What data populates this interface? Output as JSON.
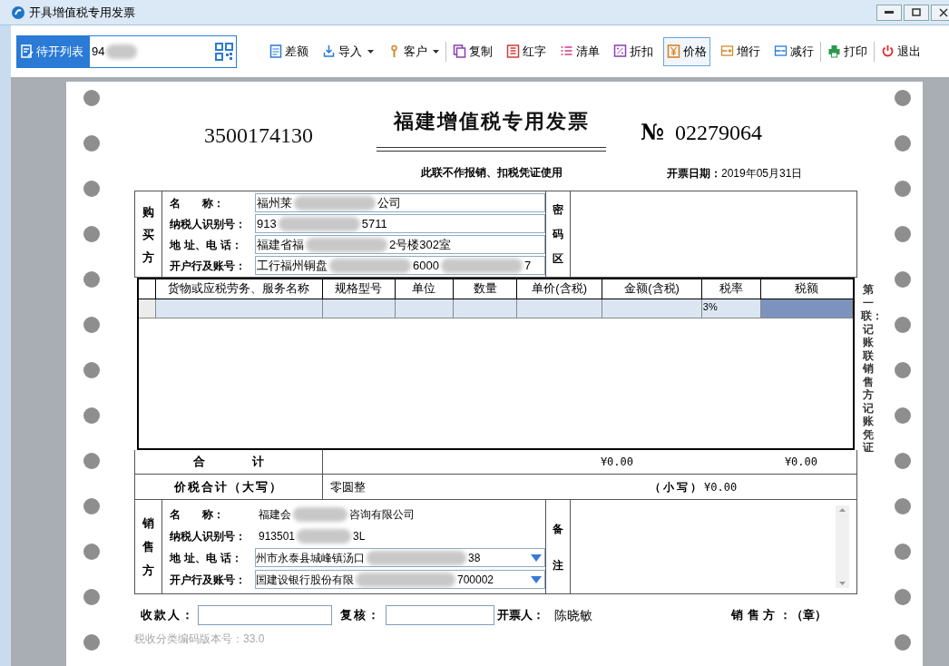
{
  "window": {
    "title": "开具增值税专用发票"
  },
  "toolbar": {
    "pending": {
      "label": "待开列表",
      "parts": [
        "94"
      ],
      "trailing_blur": true
    },
    "buttons": [
      {
        "label": "差额",
        "dropdown": false,
        "separator_before": false,
        "selected": false
      },
      {
        "label": "导入",
        "dropdown": true,
        "separator_before": false,
        "selected": false
      },
      {
        "label": "客户",
        "dropdown": true,
        "separator_before": false,
        "selected": false
      },
      {
        "label": "复制",
        "dropdown": false,
        "separator_before": true,
        "selected": false
      },
      {
        "label": "红字",
        "dropdown": false,
        "separator_before": false,
        "selected": false
      },
      {
        "label": "清单",
        "dropdown": false,
        "separator_before": false,
        "selected": false
      },
      {
        "label": "折扣",
        "dropdown": false,
        "separator_before": false,
        "selected": false
      },
      {
        "label": "价格",
        "dropdown": false,
        "separator_before": false,
        "selected": true
      },
      {
        "label": "增行",
        "dropdown": false,
        "separator_before": false,
        "selected": false
      },
      {
        "label": "减行",
        "dropdown": false,
        "separator_before": false,
        "selected": false
      },
      {
        "label": "打印",
        "dropdown": false,
        "separator_before": true,
        "selected": false
      },
      {
        "label": "退出",
        "dropdown": false,
        "separator_before": true,
        "selected": false
      }
    ]
  },
  "invoice": {
    "code": "3500174130",
    "title": "福建增值税专用发票",
    "number_mark": "№",
    "number": "02279064",
    "notice": "此联不作报销、扣税凭证使用",
    "date_label": "开票日期：",
    "date": "2019年05月31日",
    "buyer": {
      "side_label": "购买方",
      "secret_label": "密码区",
      "fields": [
        {
          "label": "名　　称：",
          "parts": [
            "福州莱",
            "公司"
          ]
        },
        {
          "label": "纳税人识别号：",
          "parts": [
            "913",
            "5711"
          ]
        },
        {
          "label": "地 址、电 话：",
          "parts": [
            "福建省福",
            "2号楼302室"
          ]
        },
        {
          "label": "开户行及账号：",
          "parts": [
            "工行福州铜盘",
            "6000",
            "7"
          ]
        }
      ]
    },
    "items": {
      "columns": [
        "货物或应税劳务、服务名称",
        "规格型号",
        "单位",
        "数量",
        "单价(含税)",
        "金额(含税)",
        "税率",
        "税额"
      ],
      "rows": [
        {
          "selected": true,
          "cells": [
            "",
            "",
            "",
            "",
            "",
            "",
            "3%",
            ""
          ]
        }
      ]
    },
    "total": {
      "label": "合　　　　计",
      "amount": "¥0.00",
      "tax": "¥0.00"
    },
    "grand_total": {
      "label": "价税合计（大写）",
      "words": "零圆整",
      "small_label": "（小写）",
      "small_amount": "¥0.00"
    },
    "seller": {
      "side_label": "销售方",
      "remark_label": "备注",
      "fields": [
        {
          "kind": "text",
          "label": "名　　称：",
          "parts": [
            "福建会",
            "咨询有限公司"
          ]
        },
        {
          "kind": "text",
          "label": "纳税人识别号：",
          "parts": [
            "913501",
            "3L"
          ]
        },
        {
          "kind": "dropdown",
          "label": "地 址、电 话：",
          "parts": [
            "州市永泰县城峰镇汤口",
            "38"
          ]
        },
        {
          "kind": "dropdown",
          "label": "开户行及账号：",
          "parts": [
            "国建设银行股份有限",
            "700002"
          ]
        }
      ]
    },
    "footer": {
      "payee_label": "收款人：",
      "reviewer_label": "复核：",
      "issuer_label": "开票人：",
      "issuer": "陈晓敏",
      "seal": "销 售 方 ：（章）"
    },
    "version": "税收分类编码版本号：33.0",
    "copy_label": "第一联：记账联销售方记账凭证"
  }
}
